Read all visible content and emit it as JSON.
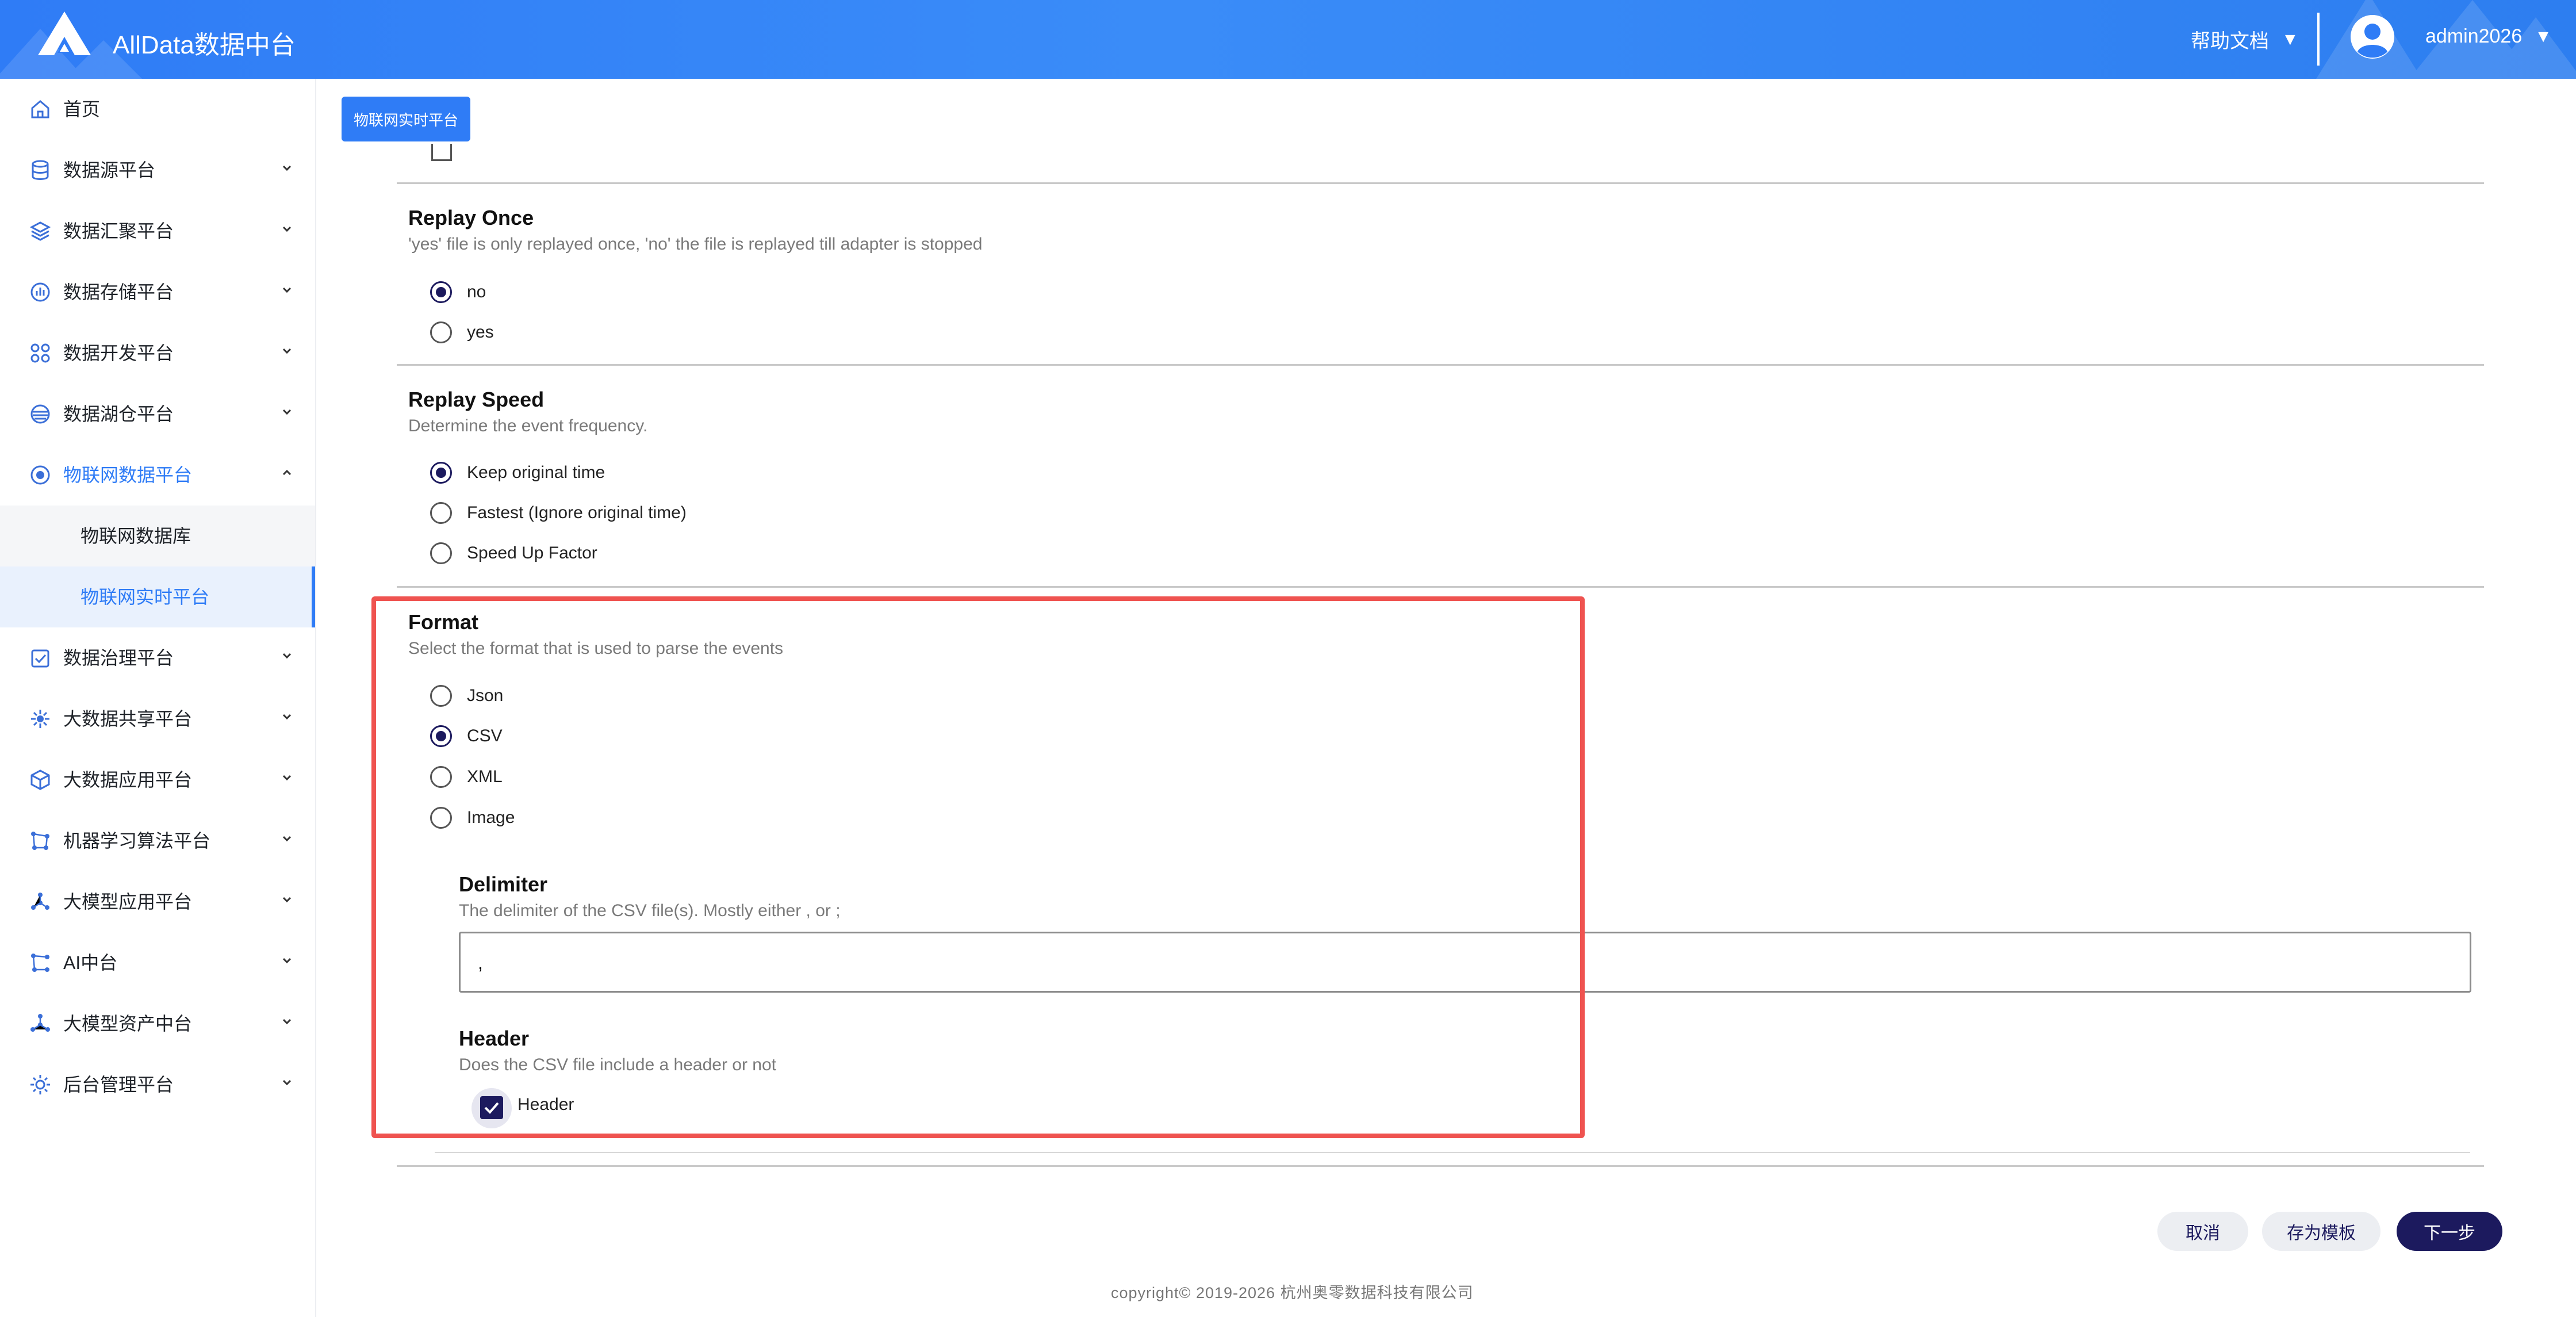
{
  "header": {
    "app_title": "AllData数据中台",
    "help_label": "帮助文档",
    "user_name": "admin2026",
    "caret": "▼"
  },
  "sidebar": {
    "items": [
      {
        "label": "首页",
        "icon": "home-icon"
      },
      {
        "label": "数据源平台",
        "icon": "database-icon"
      },
      {
        "label": "数据汇聚平台",
        "icon": "layers-icon"
      },
      {
        "label": "数据存储平台",
        "icon": "storage-chart-icon"
      },
      {
        "label": "数据开发平台",
        "icon": "grid-nodes-icon"
      },
      {
        "label": "数据湖仓平台",
        "icon": "lake-icon"
      },
      {
        "label": "物联网数据平台",
        "icon": "iot-icon",
        "expanded": true,
        "active": true
      },
      {
        "label": "数据治理平台",
        "icon": "governance-icon"
      },
      {
        "label": "大数据共享平台",
        "icon": "share-icon"
      },
      {
        "label": "大数据应用平台",
        "icon": "cube-icon"
      },
      {
        "label": "机器学习算法平台",
        "icon": "ml-icon"
      },
      {
        "label": "大模型应用平台",
        "icon": "model-app-icon"
      },
      {
        "label": "AI中台",
        "icon": "ai-icon"
      },
      {
        "label": "大模型资产中台",
        "icon": "asset-icon"
      },
      {
        "label": "后台管理平台",
        "icon": "admin-gear-icon"
      }
    ],
    "sub_items": [
      {
        "label": "物联网数据库"
      },
      {
        "label": "物联网实时平台",
        "selected": true
      }
    ]
  },
  "breadcrumb": {
    "tab_label": "物联网实时平台"
  },
  "replay_once": {
    "title": "Replay Once",
    "description": "'yes' file is only replayed once, 'no' the file is replayed till adapter is stopped",
    "options": [
      "no",
      "yes"
    ],
    "selected": "no"
  },
  "replay_speed": {
    "title": "Replay Speed",
    "description": "Determine the event frequency.",
    "options": [
      "Keep original time",
      "Fastest (Ignore original time)",
      "Speed Up Factor"
    ],
    "selected": "Keep original time"
  },
  "format": {
    "title": "Format",
    "description": "Select the format that is used to parse the events",
    "options": [
      "Json",
      "CSV",
      "XML",
      "Image"
    ],
    "selected": "CSV"
  },
  "delimiter": {
    "title": "Delimiter",
    "description": "The delimiter of the CSV file(s). Mostly either , or ;",
    "value": ","
  },
  "header_option": {
    "title": "Header",
    "description": "Does the CSV file include a header or not",
    "checkbox_label": "Header",
    "checked": true
  },
  "actions": {
    "cancel": "取消",
    "save_template": "存为模板",
    "next": "下一步"
  },
  "footer": {
    "copyright": "copyright© 2019-2026 杭州奥零数据科技有限公司"
  },
  "colors": {
    "brand_blue": "#2f7cf6",
    "radio_navy": "#1c1a5e",
    "highlight_red": "#ef5350"
  }
}
